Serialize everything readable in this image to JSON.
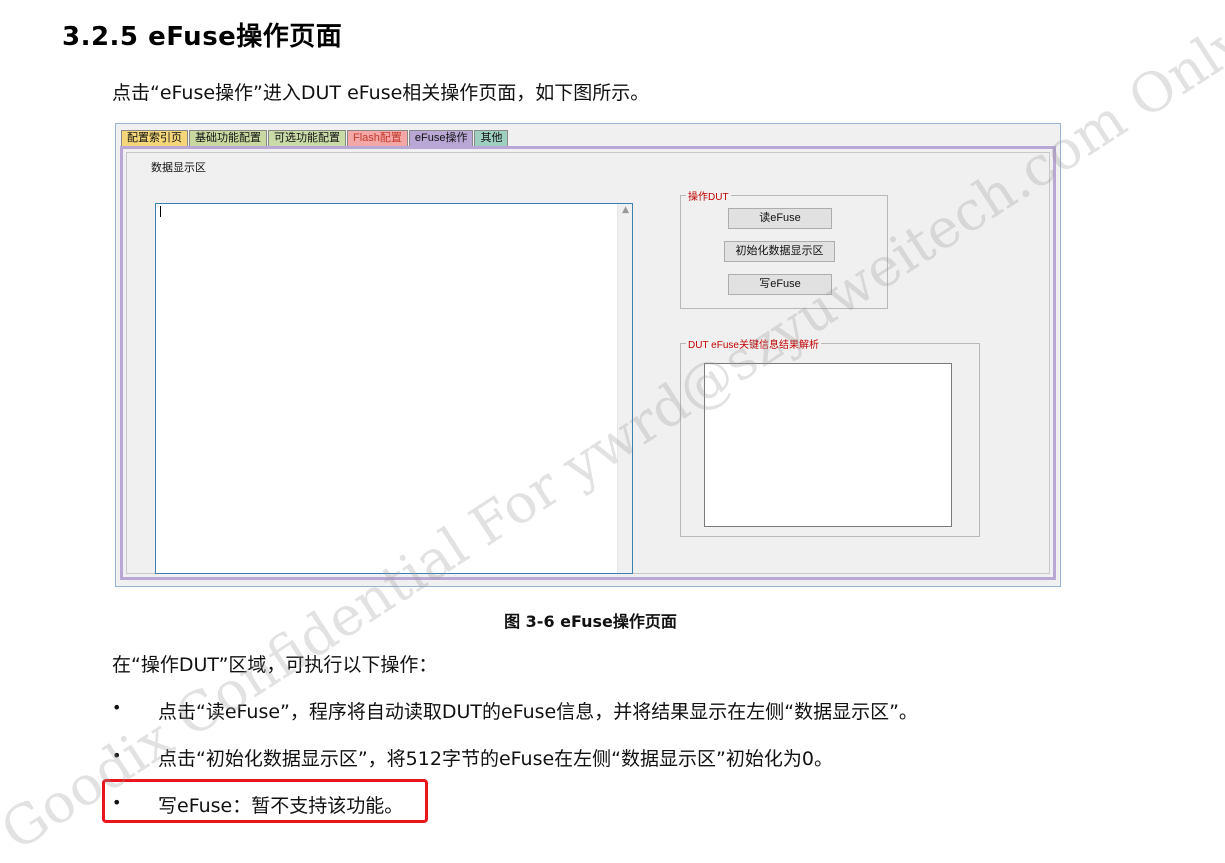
{
  "heading": "3.2.5 eFuse操作页面",
  "intro": "点击“eFuse操作”进入DUT eFuse相关操作页面，如下图所示。",
  "app": {
    "tabs": [
      {
        "label": "配置索引页",
        "color": "#f5d77a"
      },
      {
        "label": "基础功能配置",
        "color": "#c8d8a0"
      },
      {
        "label": "可选功能配置",
        "color": "#c9dba7"
      },
      {
        "label": "Flash配置",
        "color": "#f4a7a7",
        "text_color": "#c0392b"
      },
      {
        "label": "eFuse操作",
        "color": "#b9a7d6"
      },
      {
        "label": "其他",
        "color": "#9fcfc0"
      }
    ],
    "data_area_label": "数据显示区",
    "operate_group": {
      "title": "操作DUT",
      "buttons": [
        "读eFuse",
        "初始化数据显示区",
        "写eFuse"
      ]
    },
    "result_group": {
      "title": "DUT eFuse关键信息结果解析"
    }
  },
  "caption": "图 3-6 eFuse操作页面",
  "section_text": "在“操作DUT”区域，可执行以下操作：",
  "bullets": [
    "点击“读eFuse”，程序将自动读取DUT的eFuse信息，并将结果显示在左侧“数据显示区”。",
    "点击“初始化数据显示区”，将512字节的eFuse在左侧“数据显示区”初始化为0。",
    "写eFuse：暂不支持该功能。"
  ],
  "bullet_symbol": "•",
  "watermark": "Goodix Confidential For ywrd@szyuweitech.com Only",
  "colors": {
    "highlight_box": "#e8161c",
    "group_title": "#c00000",
    "active_tab_border": "#b9a7d6"
  }
}
